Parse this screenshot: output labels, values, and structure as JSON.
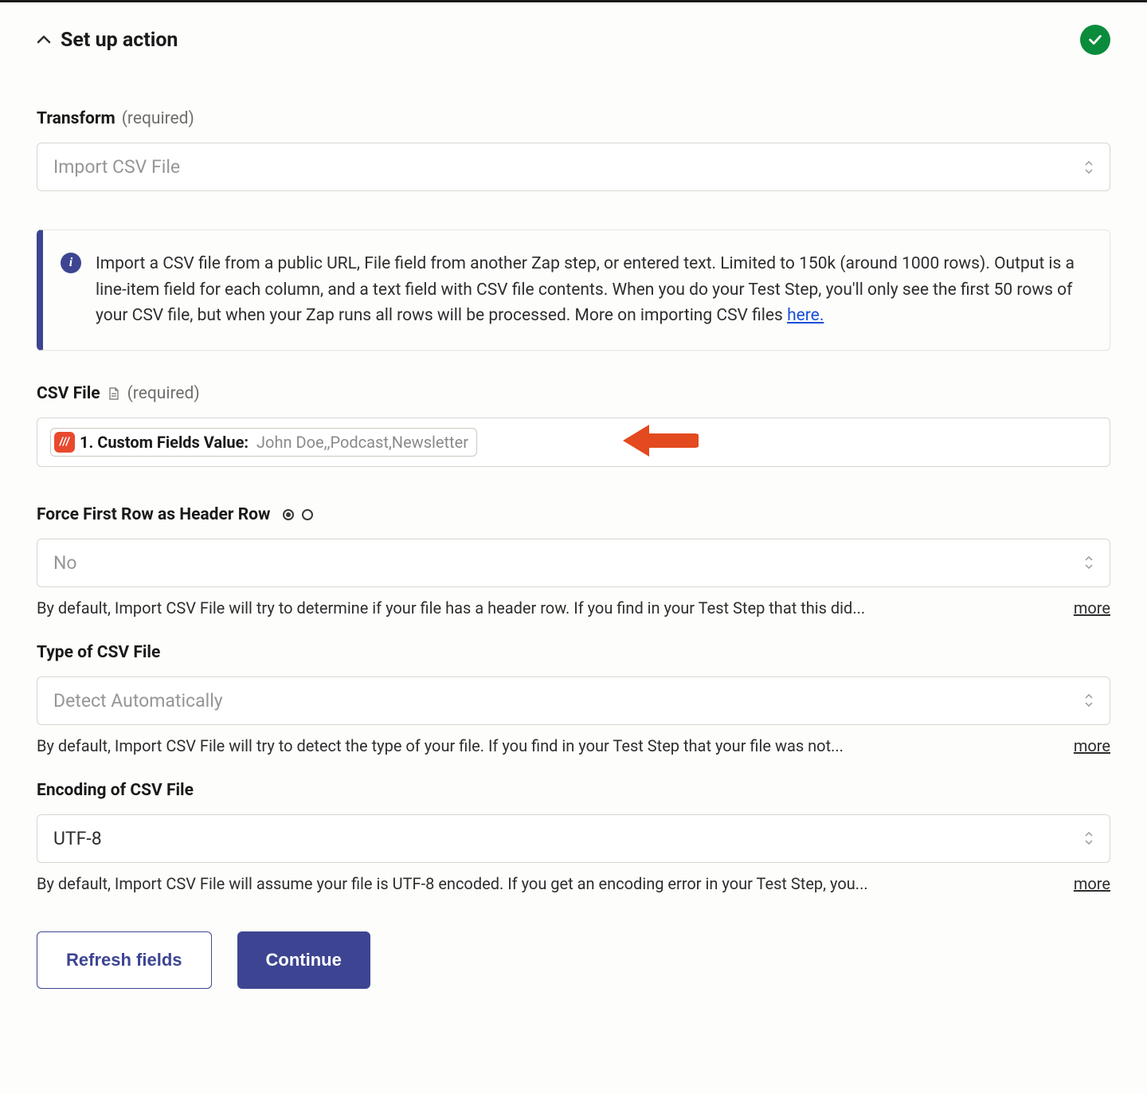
{
  "header": {
    "title": "Set up action"
  },
  "transform": {
    "label": "Transform",
    "required": "(required)",
    "value": "Import CSV File"
  },
  "info": {
    "text": "Import a CSV file from a public URL, File field from another Zap step, or entered text. Limited to 150k (around 1000 rows). Output is a line-item field for each column, and a text field with CSV file contents. When you do your Test Step, you'll only see the first 50 rows of your CSV file, but when your Zap runs all rows will be processed. More on importing CSV files ",
    "link_text": "here."
  },
  "csv_file": {
    "label": "CSV File",
    "required": "(required)",
    "pill_label": "1. Custom Fields Value:",
    "pill_value": "John Doe,,Podcast,Newsletter"
  },
  "force_header": {
    "label": "Force First Row as Header Row",
    "value": "No",
    "helper": "By default, Import CSV File will try to determine if your file has a header row. If you find in your Test Step that this did...",
    "more": "more"
  },
  "csv_type": {
    "label": "Type of CSV File",
    "value": "Detect Automatically",
    "helper": "By default, Import CSV File will try to detect the type of your file. If you find in your Test Step that your file was not...",
    "more": "more"
  },
  "encoding": {
    "label": "Encoding of CSV File",
    "value": "UTF-8",
    "helper": "By default, Import CSV File will assume your file is UTF-8 encoded. If you get an encoding error in your Test Step, you...",
    "more": "more"
  },
  "buttons": {
    "refresh": "Refresh fields",
    "continue": "Continue"
  }
}
